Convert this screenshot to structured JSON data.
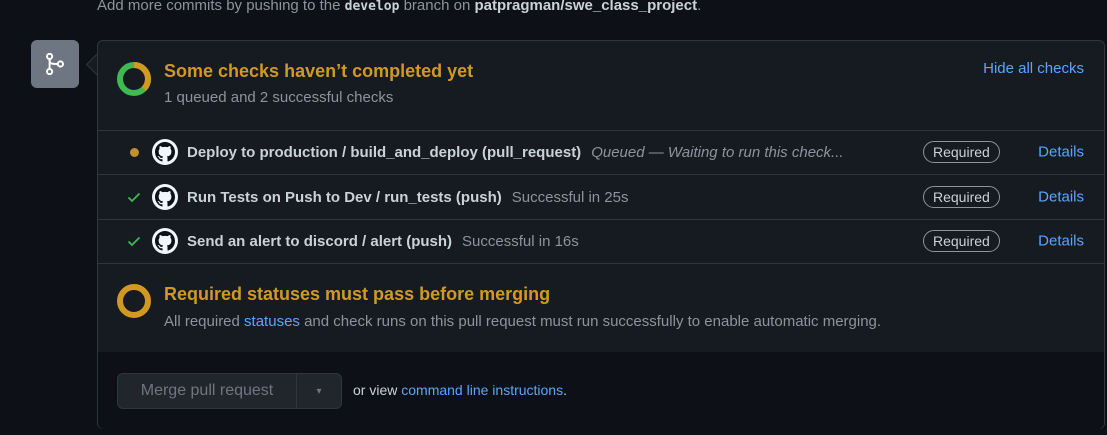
{
  "top_note": {
    "prefix": "Add more commits by pushing to the",
    "branch": "develop",
    "middle": "branch on",
    "repo": "patpragman/swe_class_project",
    "suffix": "."
  },
  "checks_header": {
    "title": "Some checks haven’t completed yet",
    "subtitle": "1 queued and 2 successful checks",
    "hide_link": "Hide all checks"
  },
  "checks": [
    {
      "status": "queued",
      "name": "Deploy to production / build_and_deploy (pull_request)",
      "desc": "Queued — Waiting to run this check...",
      "badge": "Required",
      "details": "Details"
    },
    {
      "status": "success",
      "name": "Run Tests on Push to Dev / run_tests (push)",
      "desc": "Successful in 25s",
      "badge": "Required",
      "details": "Details"
    },
    {
      "status": "success",
      "name": "Send an alert to discord / alert (push)",
      "desc": "Successful in 16s",
      "badge": "Required",
      "details": "Details"
    }
  ],
  "required_section": {
    "title": "Required statuses must pass before merging",
    "sub_prefix": "All required",
    "sub_link": "statuses",
    "sub_suffix": "and check runs on this pull request must run successfully to enable automatic merging."
  },
  "merge": {
    "button_label": "Merge pull request",
    "caret": "▾",
    "or_view": "or view",
    "cli_link": "command line instructions",
    "period": "."
  },
  "colors": {
    "pending": "#d29922",
    "success": "#3fb950",
    "link": "#58a6ff"
  }
}
